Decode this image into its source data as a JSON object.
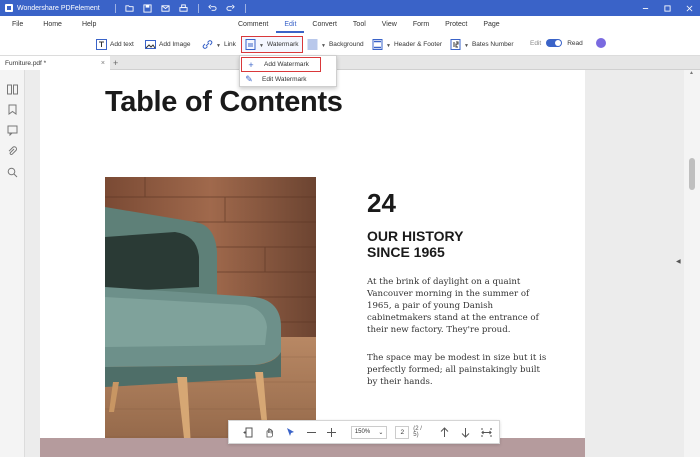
{
  "app": {
    "title": "Wondershare PDFelement",
    "brand_color": "#3a63c8"
  },
  "titlebar": {
    "icons": [
      "folder-icon",
      "save-icon",
      "email-icon",
      "print-icon",
      "undo-icon",
      "redo-icon",
      "minimize-icon",
      "maximize-icon",
      "close-icon"
    ]
  },
  "menu": {
    "left": [
      "File",
      "Home",
      "Help"
    ],
    "center": [
      "Comment",
      "Edit",
      "Convert",
      "Tool",
      "View",
      "Form",
      "Protect",
      "Page"
    ],
    "active": "Edit"
  },
  "toolbar": {
    "add_text": "Add text",
    "add_image": "Add Image",
    "link": "Link",
    "watermark": "Watermark",
    "background": "Background",
    "header_footer": "Header & Footer",
    "bates_number": "Bates Number",
    "mode_edit": "Edit",
    "mode_read": "Read"
  },
  "watermark_menu": {
    "add": "Add Watermark",
    "edit": "Edit Watermark"
  },
  "tab": {
    "filename": "Furniture.pdf *",
    "close": "×",
    "add": "+"
  },
  "document": {
    "heading": "Table of Contents",
    "number": "24",
    "section_title_1": "OUR HISTORY",
    "section_title_2": "SINCE 1965",
    "paragraph_1": "At the brink of daylight on a quaint Vancouver morning in the summer of 1965, a pair of young Danish cabinetmakers stand at the entrance of their new factory. They're proud.",
    "paragraph_2": "The space may be modest in size but it is perfectly formed; all painstakingly built by their hands."
  },
  "viewbar": {
    "zoom": "150%",
    "page_current": "2",
    "page_count": "(2 / 5)"
  }
}
